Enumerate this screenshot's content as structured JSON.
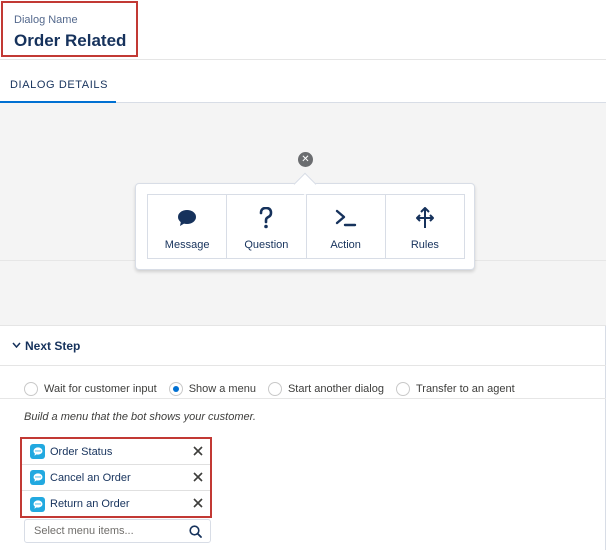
{
  "dialog": {
    "name_label": "Dialog Name",
    "name_value": "Order Related"
  },
  "tabs": [
    {
      "label": "DIALOG DETAILS",
      "active": true
    }
  ],
  "palette": {
    "items": [
      {
        "label": "Message",
        "icon": "speech-bubble-icon"
      },
      {
        "label": "Question",
        "icon": "question-mark-icon"
      },
      {
        "label": "Action",
        "icon": "terminal-prompt-icon"
      },
      {
        "label": "Rules",
        "icon": "split-arrows-icon"
      }
    ]
  },
  "next_step": {
    "title": "Next Step",
    "options": [
      {
        "label": "Wait for customer input",
        "selected": false
      },
      {
        "label": "Show a menu",
        "selected": true
      },
      {
        "label": "Start another dialog",
        "selected": false
      },
      {
        "label": "Transfer to an agent",
        "selected": false
      }
    ],
    "hint": "Build a menu that the bot shows your customer.",
    "menu_items": [
      {
        "label": "Order Status"
      },
      {
        "label": "Cancel an Order"
      },
      {
        "label": "Return an Order"
      }
    ],
    "search_placeholder": "Select menu items..."
  },
  "colors": {
    "accent": "#0070d2",
    "highlight_border": "#c23934",
    "chip_icon": "#22a9e0",
    "canvas_bg": "#f4f4f4",
    "text_primary": "#16325c"
  }
}
